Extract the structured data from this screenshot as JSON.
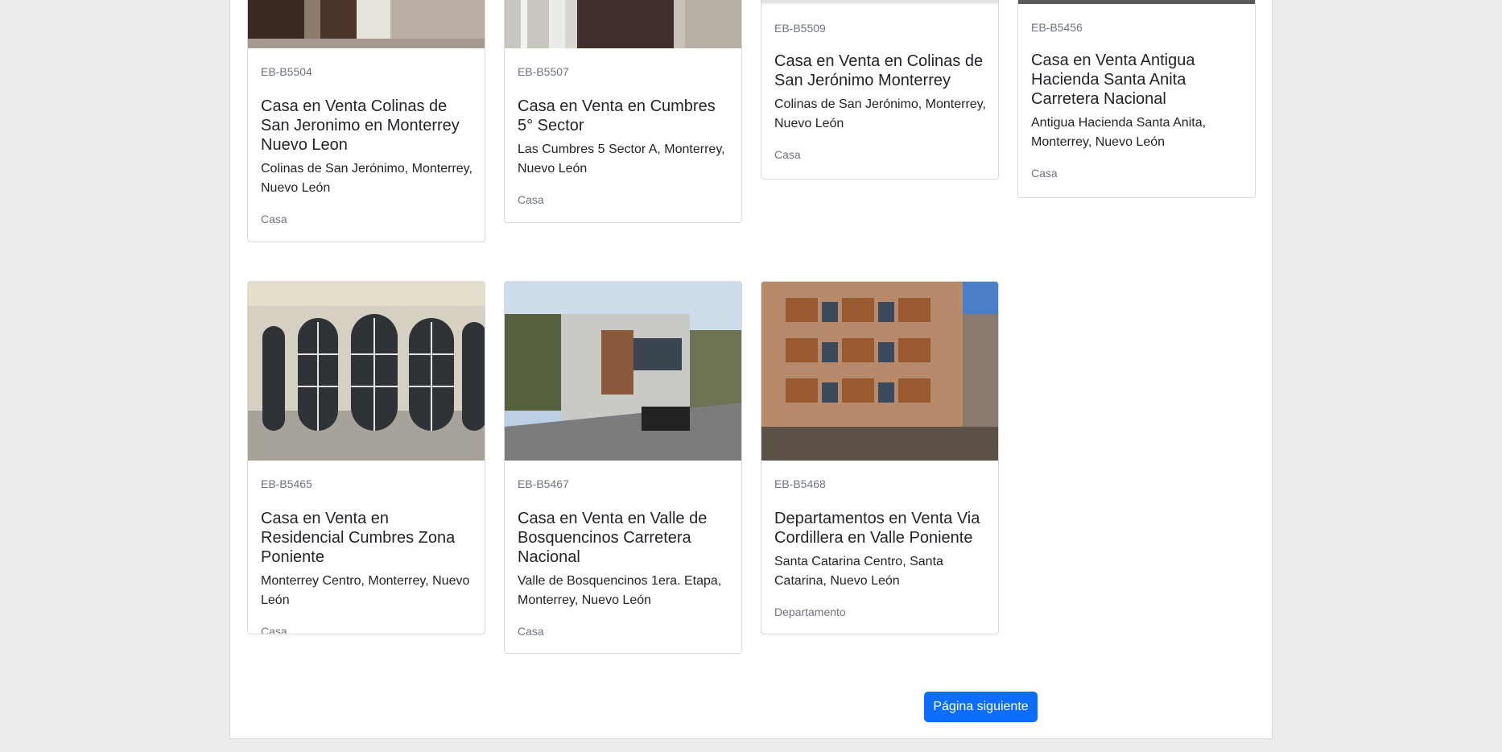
{
  "listings": [
    {
      "code": "EB-B5504",
      "title": "Casa en Venta Colinas de San Jeronimo en Monterrey Nuevo Leon",
      "address": "Colinas de San Jerónimo, Monterrey, Nuevo León",
      "type": "Casa"
    },
    {
      "code": "EB-B5507",
      "title": "Casa en Venta en Cumbres 5° Sector",
      "address": "Las Cumbres 5 Sector A, Monterrey, Nuevo León",
      "type": "Casa"
    },
    {
      "code": "EB-B5509",
      "title": "Casa en Venta en Colinas de San Jerónimo Monterrey",
      "address": "Colinas de San Jerónimo, Monterrey, Nuevo León",
      "type": "Casa"
    },
    {
      "code": "EB-B5456",
      "title": "Casa en Venta Antigua Hacienda Santa Anita Carretera Nacional",
      "address": "Antigua Hacienda Santa Anita, Monterrey, Nuevo León",
      "type": "Casa"
    },
    {
      "code": "EB-B5465",
      "title": "Casa en Venta en Residencial Cumbres Zona Poniente",
      "address": "Monterrey Centro, Monterrey, Nuevo León",
      "type": "Casa"
    },
    {
      "code": "EB-B5467",
      "title": "Casa en Venta en Valle de Bosquencinos Carretera Nacional",
      "address": "Valle de Bosquencinos 1era. Etapa, Monterrey, Nuevo León",
      "type": "Casa"
    },
    {
      "code": "EB-B5468",
      "title": "Departamentos en Venta Via Cordillera en Valle Poniente",
      "address": "Santa Catarina Centro, Santa Catarina, Nuevo León",
      "type": "Departamento"
    }
  ],
  "pagination": {
    "next_label": "Página siguiente"
  }
}
